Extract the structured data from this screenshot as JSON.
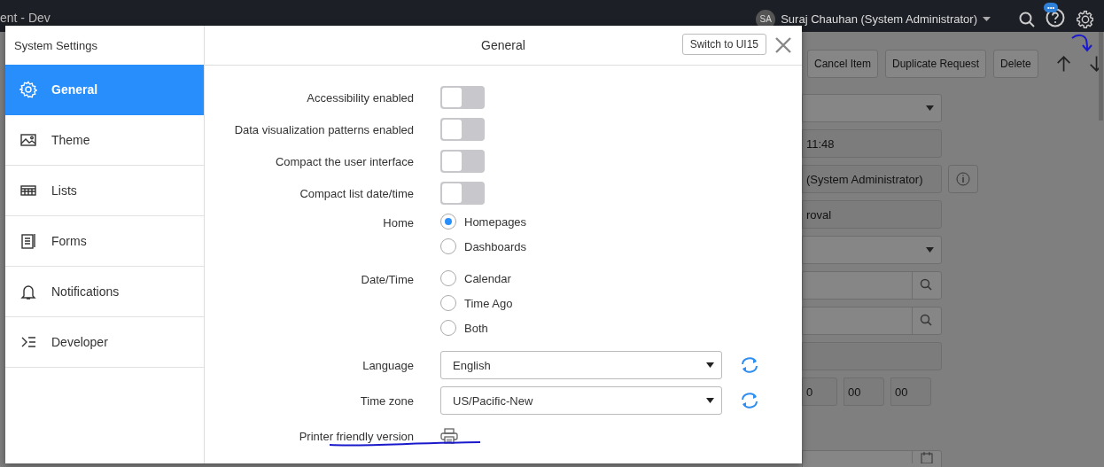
{
  "app_bar": {
    "title": "ent - Dev",
    "avatar": "SA",
    "user": "Suraj Chauhan (System Administrator)",
    "help_badge": "•••"
  },
  "background": {
    "toolbar": [
      "Cancel Item",
      "Duplicate Request",
      "Delete"
    ],
    "fields": [
      {
        "kind": "select"
      },
      {
        "kind": "readonly",
        "value": "11:48"
      },
      {
        "kind": "info",
        "value": "(System Administrator)"
      },
      {
        "kind": "readonly",
        "value": "roval"
      },
      {
        "kind": "select"
      },
      {
        "kind": "lookup"
      },
      {
        "kind": "lookup"
      },
      {
        "kind": "readonly"
      },
      {
        "kind": "time",
        "parts": [
          "0",
          "00",
          "00"
        ]
      },
      {
        "kind": "date"
      }
    ]
  },
  "dialog": {
    "title": "System Settings",
    "heading": "General",
    "switch_button": "Switch to UI15",
    "nav": [
      {
        "label": "General",
        "selected": true
      },
      {
        "label": "Theme",
        "selected": false
      },
      {
        "label": "Lists",
        "selected": false
      },
      {
        "label": "Forms",
        "selected": false
      },
      {
        "label": "Notifications",
        "selected": false
      },
      {
        "label": "Developer",
        "selected": false
      }
    ],
    "settings": [
      {
        "kind": "toggle",
        "label": "Accessibility enabled",
        "on": false
      },
      {
        "kind": "toggle",
        "label": "Data visualization patterns enabled",
        "on": false
      },
      {
        "kind": "toggle",
        "label": "Compact the user interface",
        "on": false
      },
      {
        "kind": "toggle",
        "label": "Compact list date/time",
        "on": false
      },
      {
        "kind": "radio",
        "label": "Home",
        "options": [
          {
            "label": "Homepages",
            "selected": true
          },
          {
            "label": "Dashboards",
            "selected": false
          }
        ]
      },
      {
        "kind": "radio",
        "label": "Date/Time",
        "options": [
          {
            "label": "Calendar",
            "selected": false
          },
          {
            "label": "Time Ago",
            "selected": false
          },
          {
            "label": "Both",
            "selected": false
          }
        ]
      },
      {
        "kind": "select",
        "label": "Language",
        "value": "English"
      },
      {
        "kind": "select",
        "label": "Time zone",
        "value": "US/Pacific-New"
      },
      {
        "kind": "print",
        "label": "Printer friendly version"
      }
    ]
  }
}
